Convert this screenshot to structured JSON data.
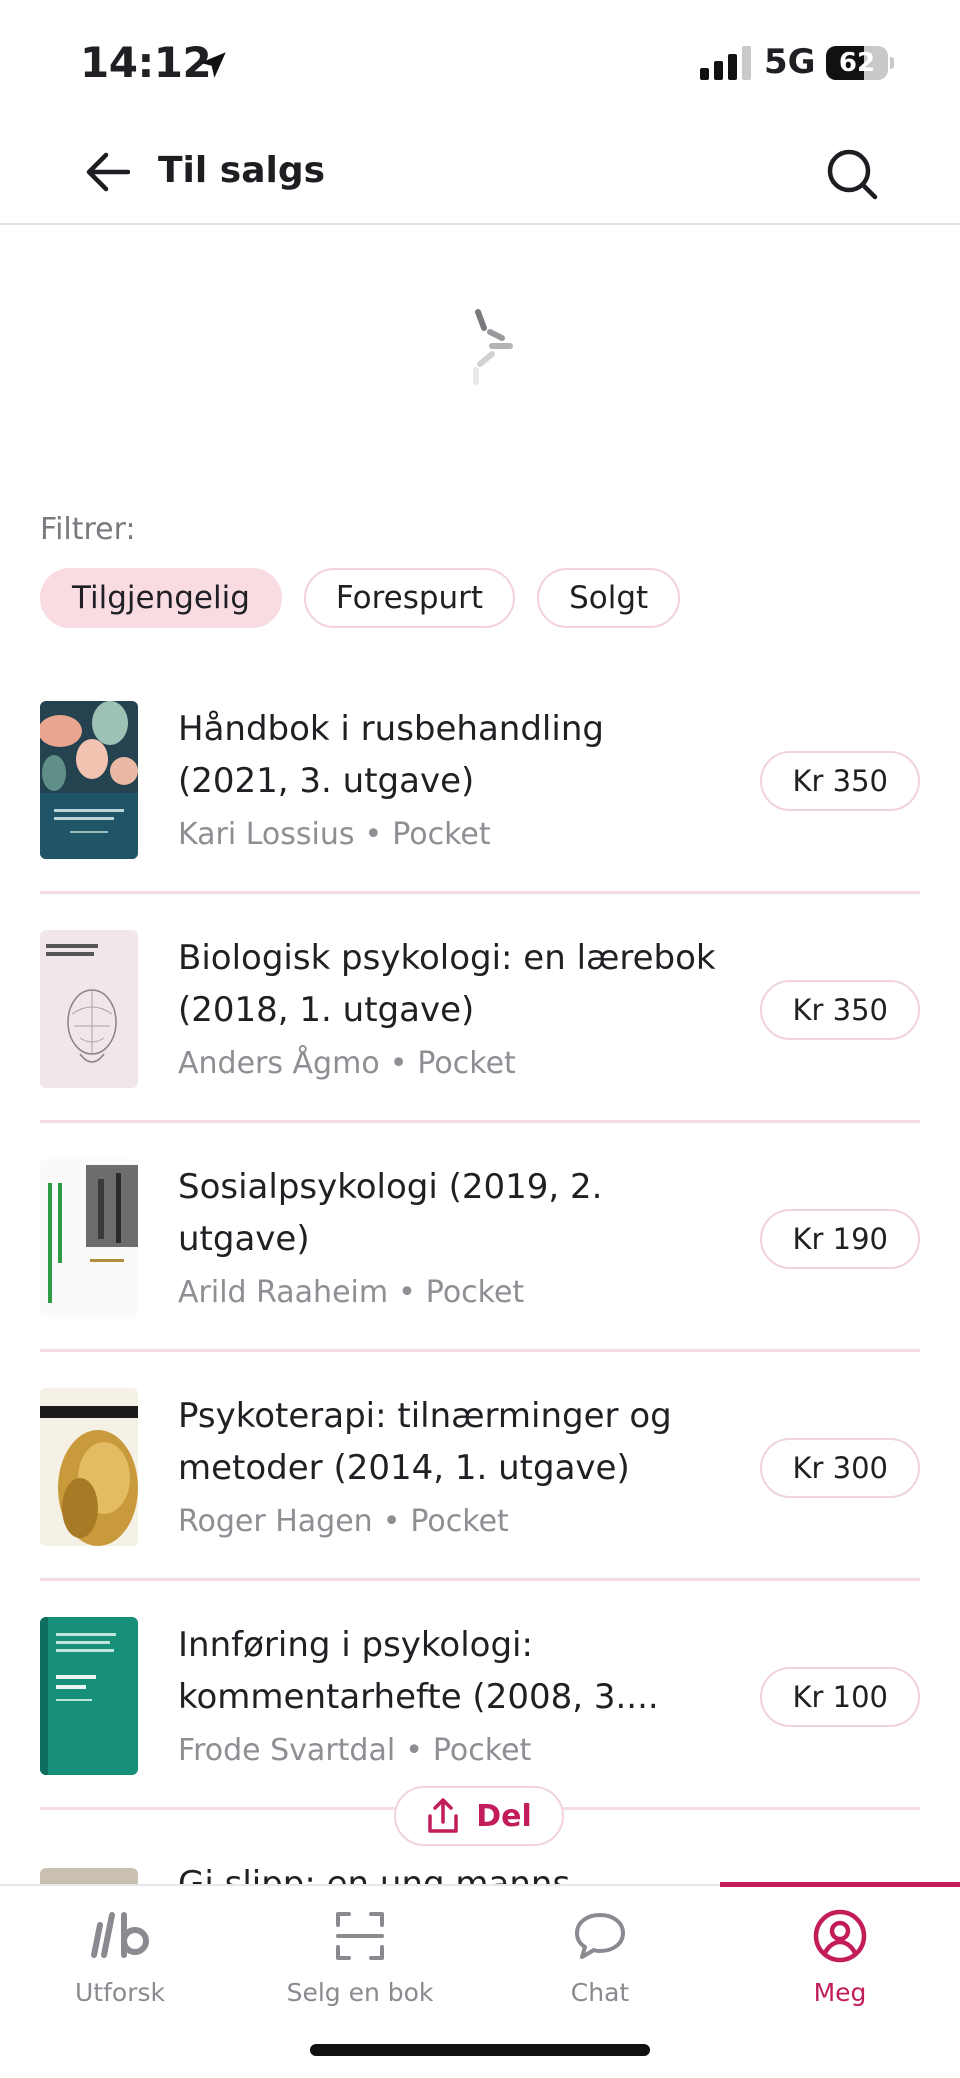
{
  "status_bar": {
    "time": "14:12",
    "network": "5G",
    "battery_percent": "62",
    "battery_level": 0.62
  },
  "header": {
    "title": "Til salgs",
    "back_icon": "arrow-left-icon",
    "search_icon": "search-icon"
  },
  "filters": {
    "label": "Filtrer:",
    "chips": [
      {
        "label": "Tilgjengelig",
        "active": true
      },
      {
        "label": "Forespurt",
        "active": false
      },
      {
        "label": "Solgt",
        "active": false
      }
    ]
  },
  "books": [
    {
      "title": "Håndbok i rusbehandling (2021, 3. utgave)",
      "author": "Kari Lossius",
      "format": "Pocket",
      "price": "Kr 350"
    },
    {
      "title": "Biologisk psykologi: en lærebok (2018, 1. utgave)",
      "author": "Anders Ågmo",
      "format": "Pocket",
      "price": "Kr 350"
    },
    {
      "title": "Sosialpsykologi (2019, 2. utgave)",
      "author": "Arild Raaheim",
      "format": "Pocket",
      "price": "Kr 190"
    },
    {
      "title": "Psykoterapi: tilnærminger og metoder (2014, 1. utgave)",
      "author": "Roger Hagen",
      "format": "Pocket",
      "price": "Kr 300"
    },
    {
      "title": "Innføring i psykologi: kommentarhefte (2008, 3....",
      "author": "Frode Svartdal",
      "format": "Pocket",
      "price": "Kr 100"
    }
  ],
  "partial_book": {
    "title": "Gi slipp: en ung manns"
  },
  "share_button": {
    "label": "Del",
    "icon": "share-icon"
  },
  "tabs": [
    {
      "label": "Utforsk",
      "icon": "explore-logo-icon",
      "active": false
    },
    {
      "label": "Selg en bok",
      "icon": "scan-icon",
      "active": false
    },
    {
      "label": "Chat",
      "icon": "chat-bubble-icon",
      "active": false
    },
    {
      "label": "Meg",
      "icon": "profile-icon",
      "active": true
    }
  ],
  "colors": {
    "accent": "#c21d5a",
    "chip_active_bg": "#f9dbe2",
    "divider": "#f5dbe2"
  }
}
